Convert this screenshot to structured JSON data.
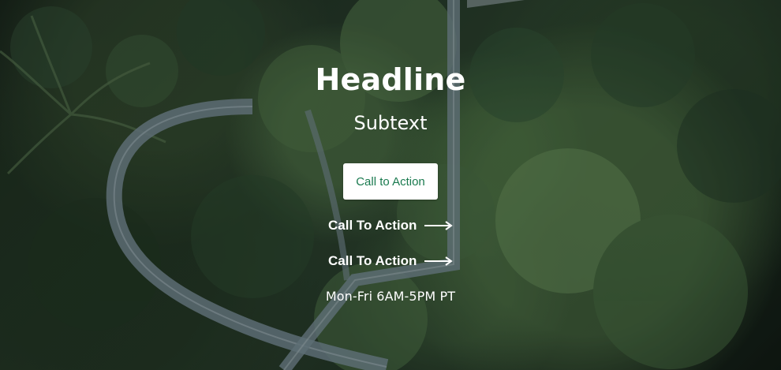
{
  "hero": {
    "headline": "Headline",
    "subtext": "Subtext",
    "primary_cta_label": "Call to Action",
    "secondary_links": [
      {
        "label": "Call To Action",
        "icon": "arrow-right-icon"
      },
      {
        "label": "Call To Action",
        "icon": "arrow-right-icon"
      }
    ],
    "hours": "Mon-Fri 6AM-5PM PT"
  },
  "colors": {
    "button_bg": "#ffffff",
    "button_text": "#1a7a4f",
    "text": "#ffffff"
  }
}
